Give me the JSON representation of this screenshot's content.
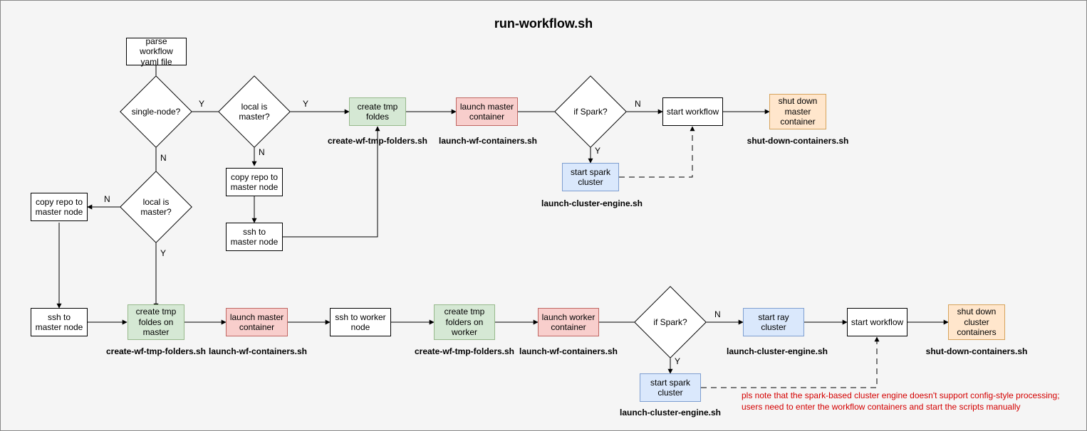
{
  "title": "run-workflow.sh",
  "nodes": {
    "parseYaml": "parse workflow yaml file",
    "singleNode": "single-node?",
    "localIsMaster1": "local is master?",
    "localIsMaster2": "local is master?",
    "copyRepo1": "copy repo to master node",
    "copyRepo2": "copy repo to master node",
    "sshMaster1": "ssh to master node",
    "sshMaster2": "ssh to master node",
    "createTmp1": "create tmp foldes",
    "createTmpMaster": "create tmp foldes on master",
    "launchMaster1": "launch master container",
    "launchMaster2": "launch master container",
    "sshWorker": "ssh to worker node",
    "createTmpWorker": "create tmp folders on worker",
    "launchWorker": "launch worker container",
    "ifSpark1": "if Spark?",
    "ifSpark2": "if Spark?",
    "startSpark1": "start spark cluster",
    "startSpark2": "start spark cluster",
    "startRay": "start ray cluster",
    "startWorkflow1": "start workflow",
    "startWorkflow2": "start workflow",
    "shutDown1": "shut down master container",
    "shutDown2": "shut down cluster containers"
  },
  "captions": {
    "createTmp1": "create-wf-tmp-folders.sh",
    "createTmpMaster": "create-wf-tmp-folders.sh",
    "createTmpWorker": "create-wf-tmp-folders.sh",
    "launchMaster1": "launch-wf-containers.sh",
    "launchMaster2": "launch-wf-containers.sh",
    "launchWorker": "launch-wf-containers.sh",
    "startSpark1": "launch-cluster-engine.sh",
    "startSpark2": "launch-cluster-engine.sh",
    "startRay": "launch-cluster-engine.sh",
    "shutDown1": "shut-down-containers.sh",
    "shutDown2": "shut-down-containers.sh"
  },
  "edgeLabels": {
    "yes": "Y",
    "no": "N"
  },
  "note": "pls note that the spark-based cluster engine doesn't support config-style processing;\nusers need to enter the workflow containers and start the scripts manually",
  "chart_data": {
    "type": "flowchart",
    "title": "run-workflow.sh",
    "nodes": [
      {
        "id": "parseYaml",
        "kind": "process",
        "label": "parse workflow yaml file"
      },
      {
        "id": "singleNode",
        "kind": "decision",
        "label": "single-node?"
      },
      {
        "id": "localIsMaster1",
        "kind": "decision",
        "label": "local is master?"
      },
      {
        "id": "createTmp1",
        "kind": "process",
        "label": "create tmp foldes",
        "script": "create-wf-tmp-folders.sh",
        "color": "green"
      },
      {
        "id": "launchMaster1",
        "kind": "process",
        "label": "launch master container",
        "script": "launch-wf-containers.sh",
        "color": "red"
      },
      {
        "id": "ifSpark1",
        "kind": "decision",
        "label": "if Spark?"
      },
      {
        "id": "startSpark1",
        "kind": "process",
        "label": "start spark cluster",
        "script": "launch-cluster-engine.sh",
        "color": "blue"
      },
      {
        "id": "startWorkflow1",
        "kind": "process",
        "label": "start workflow"
      },
      {
        "id": "shutDown1",
        "kind": "process",
        "label": "shut down master container",
        "script": "shut-down-containers.sh",
        "color": "yellow"
      },
      {
        "id": "copyRepo1",
        "kind": "process",
        "label": "copy repo to master node"
      },
      {
        "id": "sshMaster1",
        "kind": "process",
        "label": "ssh to master node"
      },
      {
        "id": "localIsMaster2",
        "kind": "decision",
        "label": "local is master?"
      },
      {
        "id": "copyRepo2",
        "kind": "process",
        "label": "copy repo to master node"
      },
      {
        "id": "sshMaster2",
        "kind": "process",
        "label": "ssh to master node"
      },
      {
        "id": "createTmpMaster",
        "kind": "process",
        "label": "create tmp foldes on master",
        "script": "create-wf-tmp-folders.sh",
        "color": "green"
      },
      {
        "id": "launchMaster2",
        "kind": "process",
        "label": "launch master container",
        "script": "launch-wf-containers.sh",
        "color": "red"
      },
      {
        "id": "sshWorker",
        "kind": "process",
        "label": "ssh to worker node"
      },
      {
        "id": "createTmpWorker",
        "kind": "process",
        "label": "create tmp folders on worker",
        "script": "create-wf-tmp-folders.sh",
        "color": "green"
      },
      {
        "id": "launchWorker",
        "kind": "process",
        "label": "launch worker container",
        "script": "launch-wf-containers.sh",
        "color": "red"
      },
      {
        "id": "ifSpark2",
        "kind": "decision",
        "label": "if Spark?"
      },
      {
        "id": "startRay",
        "kind": "process",
        "label": "start ray cluster",
        "script": "launch-cluster-engine.sh",
        "color": "blue"
      },
      {
        "id": "startSpark2",
        "kind": "process",
        "label": "start spark cluster",
        "script": "launch-cluster-engine.sh",
        "color": "blue"
      },
      {
        "id": "startWorkflow2",
        "kind": "process",
        "label": "start workflow"
      },
      {
        "id": "shutDown2",
        "kind": "process",
        "label": "shut down cluster containers",
        "script": "shut-down-containers.sh",
        "color": "yellow"
      }
    ],
    "edges": [
      {
        "from": "parseYaml",
        "to": "singleNode"
      },
      {
        "from": "singleNode",
        "to": "localIsMaster1",
        "label": "Y"
      },
      {
        "from": "singleNode",
        "to": "localIsMaster2",
        "label": "N"
      },
      {
        "from": "localIsMaster1",
        "to": "createTmp1",
        "label": "Y"
      },
      {
        "from": "localIsMaster1",
        "to": "copyRepo1",
        "label": "N"
      },
      {
        "from": "copyRepo1",
        "to": "sshMaster1"
      },
      {
        "from": "sshMaster1",
        "to": "createTmp1"
      },
      {
        "from": "createTmp1",
        "to": "launchMaster1"
      },
      {
        "from": "launchMaster1",
        "to": "ifSpark1"
      },
      {
        "from": "ifSpark1",
        "to": "startWorkflow1",
        "label": "N"
      },
      {
        "from": "ifSpark1",
        "to": "startSpark1",
        "label": "Y"
      },
      {
        "from": "startSpark1",
        "to": "startWorkflow1",
        "style": "dashed"
      },
      {
        "from": "startWorkflow1",
        "to": "shutDown1"
      },
      {
        "from": "localIsMaster2",
        "to": "copyRepo2",
        "label": "N"
      },
      {
        "from": "localIsMaster2",
        "to": "createTmpMaster",
        "label": "Y"
      },
      {
        "from": "copyRepo2",
        "to": "sshMaster2"
      },
      {
        "from": "sshMaster2",
        "to": "createTmpMaster"
      },
      {
        "from": "createTmpMaster",
        "to": "launchMaster2"
      },
      {
        "from": "launchMaster2",
        "to": "sshWorker"
      },
      {
        "from": "sshWorker",
        "to": "createTmpWorker"
      },
      {
        "from": "createTmpWorker",
        "to": "launchWorker"
      },
      {
        "from": "launchWorker",
        "to": "ifSpark2"
      },
      {
        "from": "ifSpark2",
        "to": "startRay",
        "label": "N"
      },
      {
        "from": "ifSpark2",
        "to": "startSpark2",
        "label": "Y"
      },
      {
        "from": "startRay",
        "to": "startWorkflow2"
      },
      {
        "from": "startSpark2",
        "to": "startWorkflow2",
        "style": "dashed"
      },
      {
        "from": "startWorkflow2",
        "to": "shutDown2"
      }
    ],
    "annotations": [
      {
        "type": "note",
        "text": "pls note that the spark-based cluster engine doesn't support config-style processing; users need to enter the workflow containers and start the scripts manually",
        "color": "red"
      }
    ]
  }
}
